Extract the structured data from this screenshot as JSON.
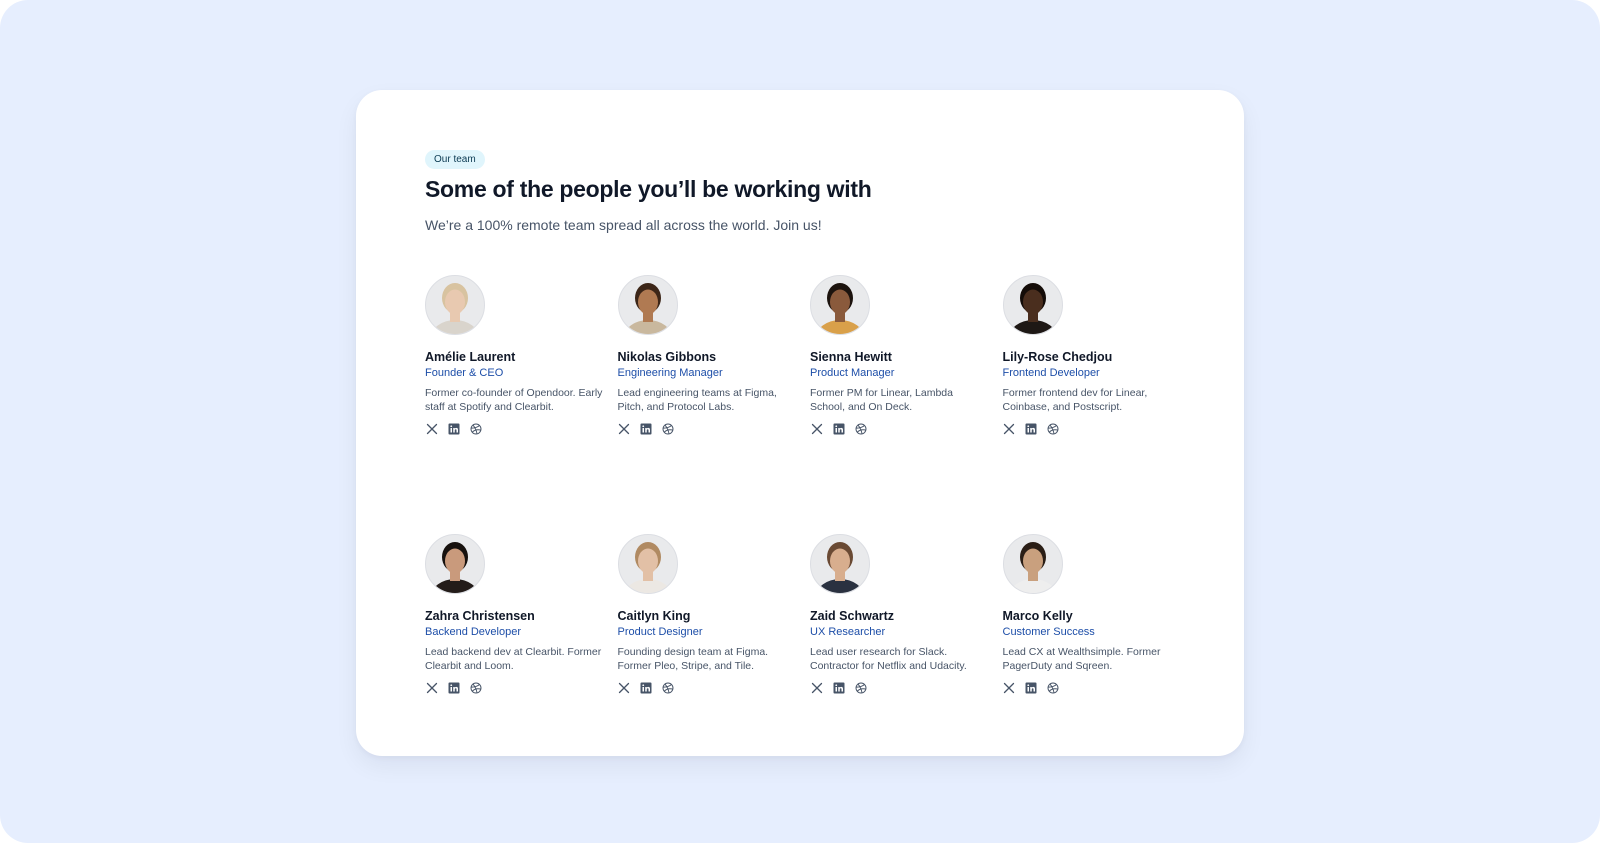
{
  "badge": "Our team",
  "title": "Some of the people you’ll be working with",
  "subtitle": "We’re a 100% remote team spread all across the world. Join us!",
  "colors": {
    "backdrop": "#e6eefe",
    "card": "#ffffff",
    "badge_bg": "#e0f5fc",
    "role_accent": "#1d4ea8",
    "icon": "#475467"
  },
  "social_icons": [
    "x-icon",
    "linkedin-icon",
    "dribbble-icon"
  ],
  "members": [
    {
      "name": "Amélie Laurent",
      "role": "Founder & CEO",
      "bio": "Former co-founder of Opendoor. Early staff at Spotify and Clearbit.",
      "skin": "#e8c9b0",
      "hair": "#d8c3a0",
      "shirt": "#d9d4cc"
    },
    {
      "name": "Nikolas Gibbons",
      "role": "Engineering Manager",
      "bio": "Lead engineering teams at Figma, Pitch, and Protocol Labs.",
      "skin": "#b07a52",
      "hair": "#3c2618",
      "shirt": "#c9b89e"
    },
    {
      "name": "Sienna Hewitt",
      "role": "Product Manager",
      "bio": "Former PM for Linear, Lambda School, and On Deck.",
      "skin": "#8a5a3c",
      "hair": "#1c130e",
      "shirt": "#d9a04a"
    },
    {
      "name": "Lily-Rose Chedjou",
      "role": "Frontend Developer",
      "bio": "Former frontend dev for Linear, Coinbase, and Postscript.",
      "skin": "#4a2e1e",
      "hair": "#140c08",
      "shirt": "#1e1815"
    },
    {
      "name": "Zahra Christensen",
      "role": "Backend Developer",
      "bio": "Lead backend dev at Clearbit. Former Clearbit and Loom.",
      "skin": "#c99a7c",
      "hair": "#17110e",
      "shirt": "#231c19"
    },
    {
      "name": "Caitlyn King",
      "role": "Product Designer",
      "bio": "Founding design team at Figma. Former Pleo, Stripe, and Tile.",
      "skin": "#e2c0a6",
      "hair": "#b08a62",
      "shirt": "#ece8e3"
    },
    {
      "name": "Zaid Schwartz",
      "role": "UX Researcher",
      "bio": "Lead user research for Slack. Contractor for Netflix and Udacity.",
      "skin": "#d8ae8e",
      "hair": "#6a4a34",
      "shirt": "#2a3140"
    },
    {
      "name": "Marco Kelly",
      "role": "Customer Success",
      "bio": "Lead CX at Wealthsimple. Former PagerDuty and Sqreen.",
      "skin": "#c9a07e",
      "hair": "#2a1e16",
      "shirt": "#eeeeee"
    }
  ]
}
